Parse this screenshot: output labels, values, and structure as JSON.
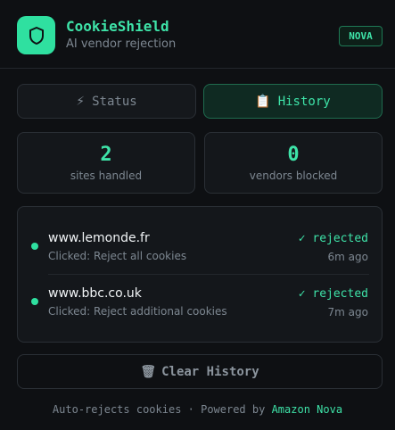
{
  "app": {
    "title": "CookieShield",
    "subtitle": "AI vendor rejection",
    "badge": "NOVA",
    "logo_icon": "shield-icon"
  },
  "tabs": [
    {
      "label": "Status",
      "icon": "lightning-icon",
      "glyph": "⚡",
      "active": false
    },
    {
      "label": "History",
      "icon": "clipboard-icon",
      "glyph": "📋",
      "active": true
    }
  ],
  "stats": [
    {
      "value": "2",
      "label": "sites handled"
    },
    {
      "value": "0",
      "label": "vendors blocked"
    }
  ],
  "history": [
    {
      "site": "www.lemonde.fr",
      "action": "Clicked: Reject all cookies",
      "status": "✓ rejected",
      "time": "6m ago"
    },
    {
      "site": "www.bbc.co.uk",
      "action": "Clicked: Reject additional cookies",
      "status": "✓ rejected",
      "time": "7m ago"
    }
  ],
  "clear_button": {
    "label": "Clear History",
    "icon": "trash-icon",
    "glyph": "🗑"
  },
  "footer": {
    "text": "Auto-rejects cookies · Powered by",
    "brand": "Amazon Nova"
  },
  "colors": {
    "accent": "#3ee3a8",
    "background": "#0e1013",
    "card": "#14171b"
  }
}
